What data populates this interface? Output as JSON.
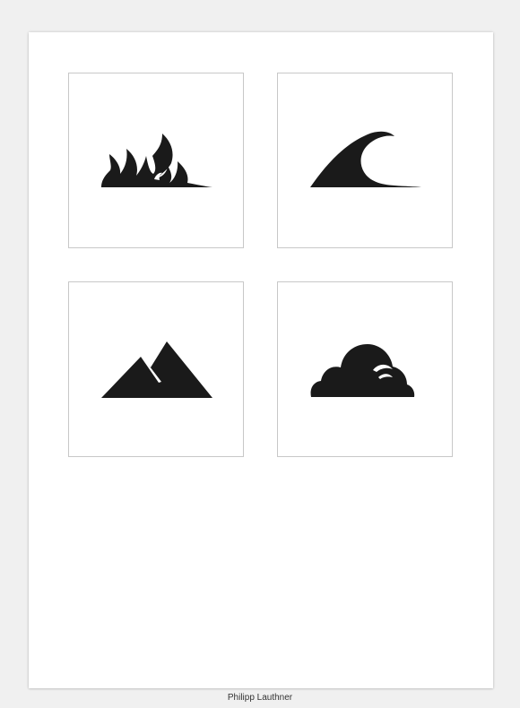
{
  "icons": [
    {
      "name": "fire-icon",
      "element": "fire"
    },
    {
      "name": "wave-icon",
      "element": "water"
    },
    {
      "name": "mountain-icon",
      "element": "earth"
    },
    {
      "name": "cloud-icon",
      "element": "air"
    }
  ],
  "colors": {
    "page_background": "#f0f0f0",
    "sheet": "#ffffff",
    "icon": "#1a1a1a",
    "tile_border": "#c8c8c8"
  },
  "footer": {
    "credit": "Philipp Lauthner"
  }
}
